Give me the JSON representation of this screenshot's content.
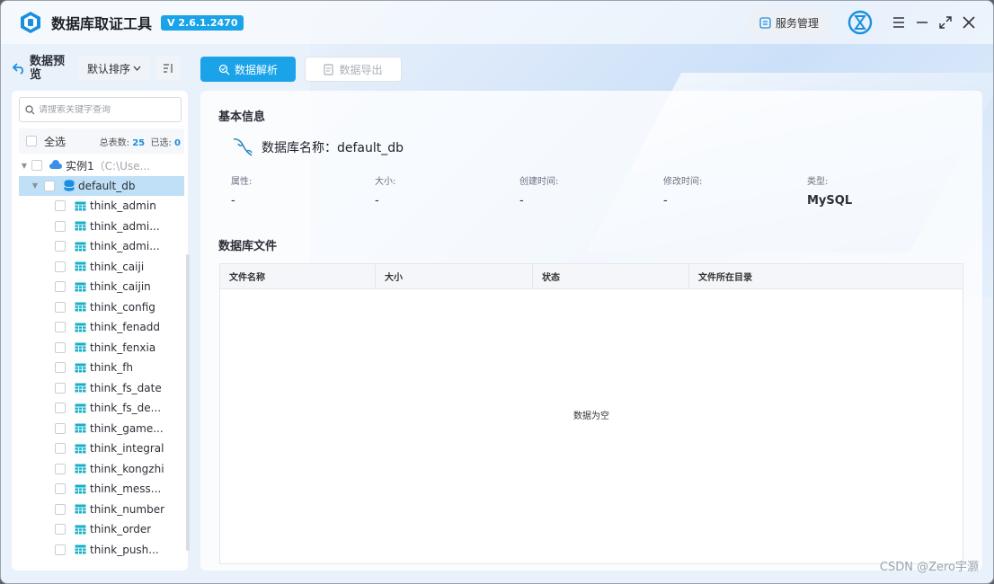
{
  "app": {
    "title": "数据库取证工具",
    "version": "V 2.6.1.2470"
  },
  "header": {
    "service_label": "服务管理"
  },
  "left": {
    "back_label": "数据预览",
    "sort_label": "默认排序",
    "search_placeholder": "请搜索关键字查询",
    "select_all_label": "全选",
    "total_label": "总表数:",
    "total_count": "25",
    "selected_label": "已选:",
    "selected_count": "0",
    "instance": {
      "label": "实例1",
      "path": "（C:\\Use..."
    },
    "database": "default_db",
    "tables": [
      "think_admin",
      "think_admi...",
      "think_admi...",
      "think_caiji",
      "think_caijin",
      "think_config",
      "think_fenadd",
      "think_fenxia",
      "think_fh",
      "think_fs_date",
      "think_fs_de...",
      "think_game...",
      "think_integral",
      "think_kongzhi",
      "think_mess...",
      "think_number",
      "think_order",
      "think_push..."
    ]
  },
  "tabs": {
    "parse_label": "数据解析",
    "export_label": "数据导出"
  },
  "main": {
    "basic_info_title": "基本信息",
    "db_name_label": "数据库名称：default_db",
    "attrs": [
      {
        "label": "属性:",
        "value": "-"
      },
      {
        "label": "大小:",
        "value": "-"
      },
      {
        "label": "创建时间:",
        "value": "-"
      },
      {
        "label": "修改时间:",
        "value": "-"
      },
      {
        "label": "类型:",
        "value": "MySQL"
      }
    ],
    "files_title": "数据库文件",
    "columns": [
      "文件名称",
      "大小",
      "状态",
      "文件所在目录"
    ],
    "empty_text": "数据为空"
  },
  "watermark": "CSDN @Zero宇灏",
  "colors": {
    "accent": "#1aa3e8",
    "selected_row": "#bfe0f7",
    "count_blue": "#1a8fe0"
  }
}
